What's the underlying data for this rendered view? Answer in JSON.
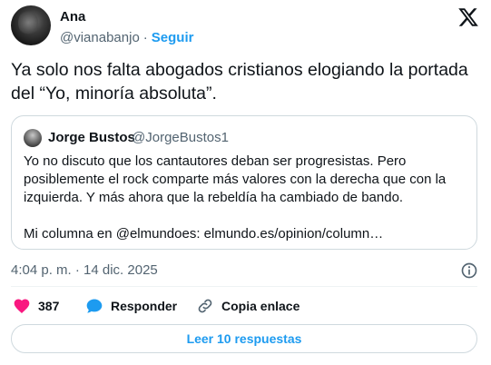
{
  "author": {
    "name": "Ana",
    "handle": "@vianabanjo",
    "separator": "·",
    "follow_label": "Seguir"
  },
  "tweet": {
    "text": "Ya solo nos falta abogados cristianos elogiando la portada del “Yo, minoría absoluta”."
  },
  "quoted": {
    "name": "Jorge Bustos",
    "handle": "@JorgeBustos1",
    "paragraph1": "Yo no discuto que los cantautores deban ser progresistas. Pero posiblemente el rock comparte más valores con la derecha que con la izquierda. Y más ahora que la rebeldía ha cambiado de bando.",
    "paragraph2": "Mi columna en @elmundoes: elmundo.es/opinion/column…"
  },
  "meta": {
    "timestamp": "4:04 p. m. · 14 dic. 2025"
  },
  "actions": {
    "likes": "387",
    "reply_label": "Responder",
    "copy_link_label": "Copia enlace"
  },
  "replies_button": "Leer 10 respuestas",
  "colors": {
    "accent": "#1d9bf0",
    "like": "#f91880",
    "text": "#0f1419",
    "secondary": "#536471",
    "border": "#cfd9de"
  },
  "icons": [
    "x-logo-icon",
    "info-icon",
    "heart-icon",
    "reply-bubble-icon",
    "link-icon"
  ]
}
